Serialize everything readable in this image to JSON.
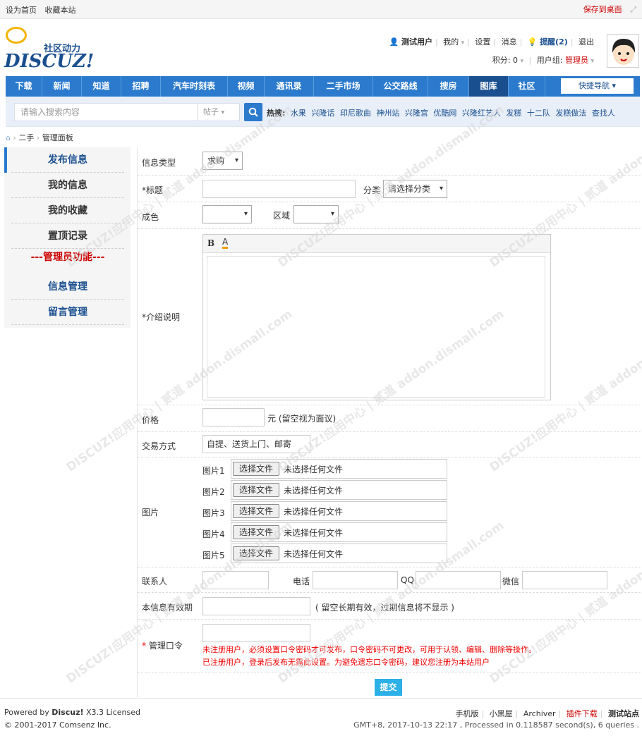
{
  "topbar": {
    "set_home": "设为首页",
    "favorite": "收藏本站",
    "save_desktop": "保存到桌面"
  },
  "logo": {
    "tagline": "社区动力",
    "word": "DISCUZ!"
  },
  "userbar": {
    "username": "测试用户",
    "mine": "我的",
    "settings": "设置",
    "messages": "消息",
    "remind": "提醒(2)",
    "logout": "退出",
    "points": "积分: 0",
    "group_label": "用户组:",
    "group": "管理员"
  },
  "nav": {
    "items": [
      "下载",
      "新闻",
      "知道",
      "招聘",
      "汽车时刻表",
      "视频",
      "通讯录",
      "二手市场",
      "公交路线",
      "搜房",
      "图库",
      "社区"
    ],
    "active": "图库",
    "quick": "快捷导航 ▾"
  },
  "search": {
    "placeholder": "请输入搜索内容",
    "type": "帖子",
    "hot_label": "热搜:",
    "hot": [
      "水果",
      "兴隆话",
      "印尼歌曲",
      "神州站",
      "兴隆宫",
      "优酷网",
      "兴隆红艺人",
      "发糕",
      "十二队",
      "发糕做法",
      "查找人"
    ]
  },
  "breadcrumb": {
    "a": "二手",
    "b": "管理面板"
  },
  "sidebar": {
    "items": [
      "发布信息",
      "我的信息",
      "我的收藏",
      "置顶记录",
      "---管理员功能---",
      "信息管理",
      "留言管理"
    ]
  },
  "form": {
    "info_type_label": "信息类型",
    "info_type_value": "求购",
    "title_label": "*标题",
    "category_label": "分类",
    "category_value": "请选择分类",
    "condition_label": "成色",
    "region_label": "区域",
    "intro_label": "*介绍说明",
    "editor_bold": "B",
    "editor_color": "A",
    "price_label": "价格",
    "price_unit": "元 (留空视为面议)",
    "trade_label": "交易方式",
    "trade_value": "自提、送货上门、邮寄",
    "images_label": "图片",
    "images": [
      "图片1",
      "图片2",
      "图片3",
      "图片4",
      "图片5"
    ],
    "choose_file": "选择文件",
    "no_file": "未选择任何文件",
    "contact_label": "联系人",
    "phone_label": "电话",
    "qq_label": "QQ",
    "wechat_label": "微信",
    "valid_label": "本信息有效期",
    "valid_hint": "( 留空长期有效，过期信息将不显示 )",
    "password_label": "* 管理口令",
    "warn1": "未注册用户，必须设置口令密码才可发布，口令密码不可更改，可用于认领、编辑、删除等操作。",
    "warn2": "已注册用户，登录后发布无需此设置。为避免遗忘口令密码，建议您注册为本站用户",
    "submit": "提交"
  },
  "footer": {
    "powered_prefix": "Powered by ",
    "powered_brand": "Discuz!",
    "powered_suffix": " X3.3 Licensed",
    "copyright": "© 2001-2017 Comsenz Inc.",
    "mobile": "手机版",
    "darkroom": "小黑屋",
    "archiver": "Archiver",
    "plugin": "插件下载",
    "site": "测试站点",
    "stats": "GMT+8, 2017-10-13 22:17 , Processed in 0.118587 second(s), 6 queries ."
  },
  "watermark": "DISCUZ!应用中心 | 贰道 addon.dismall.com"
}
